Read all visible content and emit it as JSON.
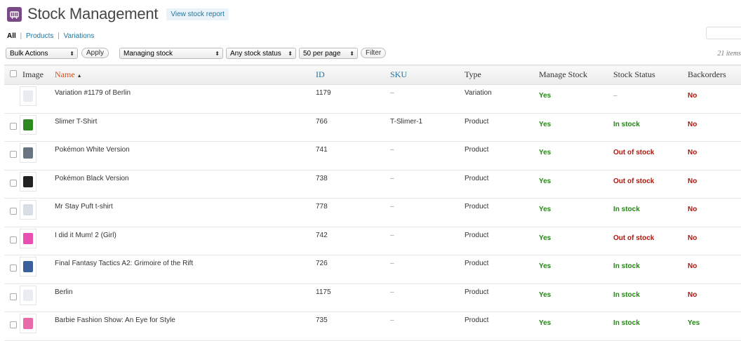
{
  "header": {
    "title": "Stock Management",
    "report_button": "View stock report"
  },
  "filters": {
    "all": "All",
    "products": "Products",
    "variations": "Variations",
    "separator": "|"
  },
  "tablenav": {
    "bulk_actions": "Bulk Actions",
    "apply": "Apply",
    "managing_stock": "Managing stock",
    "stock_status": "Any stock status",
    "per_page": "50 per page",
    "filter": "Filter",
    "items_count": "21 items"
  },
  "columns": {
    "image": "Image",
    "name": "Name",
    "id": "ID",
    "sku": "SKU",
    "type": "Type",
    "manage_stock": "Manage Stock",
    "stock_status": "Stock Status",
    "backorders": "Backorders"
  },
  "rows": [
    {
      "name": "Variation #1179 of Berlin",
      "id": "1179",
      "sku": "–",
      "type": "Variation",
      "manage": "Yes",
      "status": "–",
      "backorders": "No",
      "thumb": "white-tshirt",
      "thumb_color": "#e8ecf2",
      "has_checkbox": false
    },
    {
      "name": "Slimer T-Shirt",
      "id": "766",
      "sku": "T-Slimer-1",
      "type": "Product",
      "manage": "Yes",
      "status": "In stock",
      "backorders": "No",
      "thumb": "green-tshirt",
      "thumb_color": "#2e8a1e",
      "has_checkbox": true
    },
    {
      "name": "Pokémon White Version",
      "id": "741",
      "sku": "–",
      "type": "Product",
      "manage": "Yes",
      "status": "Out of stock",
      "backorders": "No",
      "thumb": "game-box",
      "thumb_color": "#6a7480",
      "has_checkbox": true
    },
    {
      "name": "Pokémon Black Version",
      "id": "738",
      "sku": "–",
      "type": "Product",
      "manage": "Yes",
      "status": "Out of stock",
      "backorders": "No",
      "thumb": "game-box-dark",
      "thumb_color": "#222222",
      "has_checkbox": true
    },
    {
      "name": "Mr Stay Puft t-shirt",
      "id": "778",
      "sku": "–",
      "type": "Product",
      "manage": "Yes",
      "status": "In stock",
      "backorders": "No",
      "thumb": "white-tshirt-print",
      "thumb_color": "#d8dde6",
      "has_checkbox": true
    },
    {
      "name": "I did it Mum! 2 (Girl)",
      "id": "742",
      "sku": "–",
      "type": "Product",
      "manage": "Yes",
      "status": "Out of stock",
      "backorders": "No",
      "thumb": "colorful-box",
      "thumb_color": "#e84fb0",
      "has_checkbox": true
    },
    {
      "name": "Final Fantasy Tactics A2: Grimoire of the Rift",
      "id": "726",
      "sku": "–",
      "type": "Product",
      "manage": "Yes",
      "status": "In stock",
      "backorders": "No",
      "thumb": "game-box-blue",
      "thumb_color": "#3b5f9a",
      "has_checkbox": true
    },
    {
      "name": "Berlin",
      "id": "1175",
      "sku": "–",
      "type": "Product",
      "manage": "Yes",
      "status": "In stock",
      "backorders": "No",
      "thumb": "white-tshirt",
      "thumb_color": "#e8ecf2",
      "has_checkbox": true
    },
    {
      "name": "Barbie Fashion Show: An Eye for Style",
      "id": "735",
      "sku": "–",
      "type": "Product",
      "manage": "Yes",
      "status": "In stock",
      "backorders": "Yes",
      "thumb": "pink-box",
      "thumb_color": "#e86aa8",
      "has_checkbox": true
    }
  ],
  "colors": {
    "link": "#21759b",
    "sorted": "#d54e21",
    "yes": "#1e8a0b",
    "no": "#b0160d",
    "brand": "#7a4a86"
  }
}
